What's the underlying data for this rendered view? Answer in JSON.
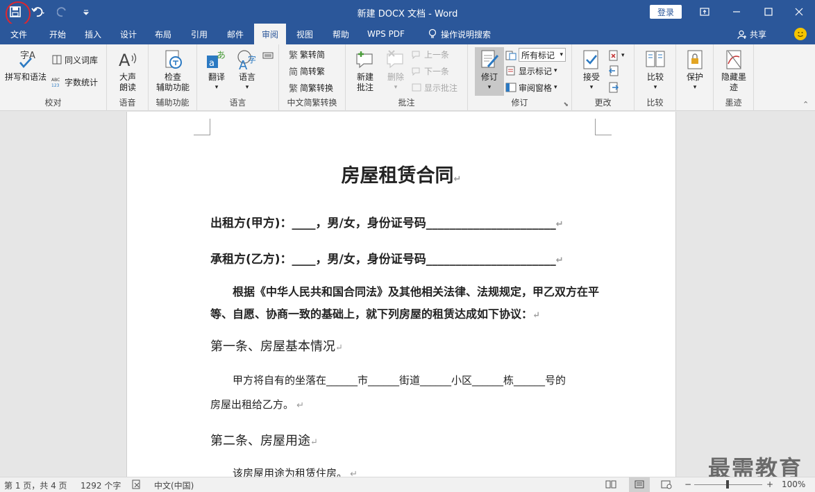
{
  "app": {
    "window_title": "新建 DOCX 文档 - Word",
    "login": "登录"
  },
  "tabs": [
    "文件",
    "开始",
    "插入",
    "设计",
    "布局",
    "引用",
    "邮件",
    "审阅",
    "视图",
    "帮助",
    "WPS PDF",
    "操作说明搜索"
  ],
  "active_tab": "审阅",
  "share": "共享",
  "ribbon": {
    "proofing": {
      "label": "校对",
      "spell": "拼写和语法",
      "thesaurus": "同义词库",
      "wordcount": "字数统计"
    },
    "speech": {
      "label": "语音",
      "read_aloud": "大声\n朗读"
    },
    "accessibility": {
      "label": "辅助功能",
      "check": "检查\n辅助功能"
    },
    "language": {
      "label": "语言",
      "translate": "翻译",
      "language": "语言"
    },
    "chinese_conv": {
      "label": "中文简繁转换",
      "to_simplified": "繁转简",
      "to_traditional": "简转繁",
      "convert": "简繁转换"
    },
    "comments": {
      "label": "批注",
      "new": "新建\n批注",
      "delete": "删除",
      "prev": "上一条",
      "next": "下一条",
      "show": "显示批注"
    },
    "tracking": {
      "label": "修订",
      "track": "修订",
      "markup": "所有标记",
      "show_markup": "显示标记",
      "pane": "审阅窗格"
    },
    "changes": {
      "label": "更改",
      "accept": "接受"
    },
    "compare": {
      "label": "比较",
      "compare": "比较"
    },
    "protect": {
      "label": "",
      "protect": "保护"
    },
    "ink": {
      "label": "墨迹",
      "hide_ink": "隐藏墨\n迹"
    }
  },
  "document": {
    "title": "房屋租赁合同",
    "lessor": "出租方(甲方)：____，男/女，身份证号码______________________",
    "lessee": "承租方(乙方)：____，男/女，身份证号码______________________",
    "preamble_1": "根据《中华人民共和国合同法》及其他相关法律、法规规定，甲乙双方在平",
    "preamble_2": "等、自愿、协商一致的基础上，就下列房屋的租赁达成如下协议：",
    "art1_title": "第一条、房屋基本情况",
    "art1_p1": "甲方将自有的坐落在______市______街道______小区______栋______号的",
    "art1_p2": "房屋出租给乙方。",
    "art2_title": "第二条、房屋用途",
    "art2_p1": "该房屋用途为租赁住房。"
  },
  "watermark": "最需教育",
  "status": {
    "page": "第 1 页，共 4 页",
    "words": "1292 个字",
    "lang": "中文(中国)",
    "zoom": "100%",
    "zoom_level": 1.0
  }
}
